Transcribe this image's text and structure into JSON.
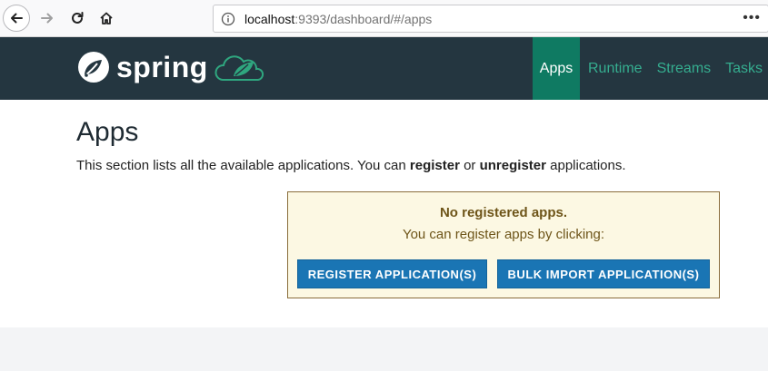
{
  "browser": {
    "url_host": "localhost",
    "url_rest": ":9393/dashboard/#/apps",
    "more_label": "•••"
  },
  "header": {
    "logo_text": "spring",
    "tabs": [
      {
        "label": "Apps",
        "active": true
      },
      {
        "label": "Runtime",
        "active": false
      },
      {
        "label": "Streams",
        "active": false
      },
      {
        "label": "Tasks",
        "active": false
      }
    ]
  },
  "main": {
    "title": "Apps",
    "description_pre": "This section lists all the available applications. You can ",
    "description_register": "register",
    "description_mid": " or ",
    "description_unregister": "unregister",
    "description_post": " applications.",
    "notice_title": "No registered apps.",
    "notice_sub": "You can register apps by clicking:",
    "register_button": "REGISTER APPLICATION(S)",
    "bulk_import_button": "BULK IMPORT APPLICATION(S)"
  },
  "colors": {
    "header_bg": "#243640",
    "active_tab": "#0f7a62",
    "tab_text": "#35ad8f",
    "button": "#1a75b4",
    "notice_bg": "#fcf8e3"
  },
  "icons": [
    "back-arrow-icon",
    "forward-arrow-icon",
    "reload-icon",
    "home-icon",
    "info-icon",
    "more-icon",
    "spring-leaf-icon",
    "cloud-leaf-icon"
  ]
}
